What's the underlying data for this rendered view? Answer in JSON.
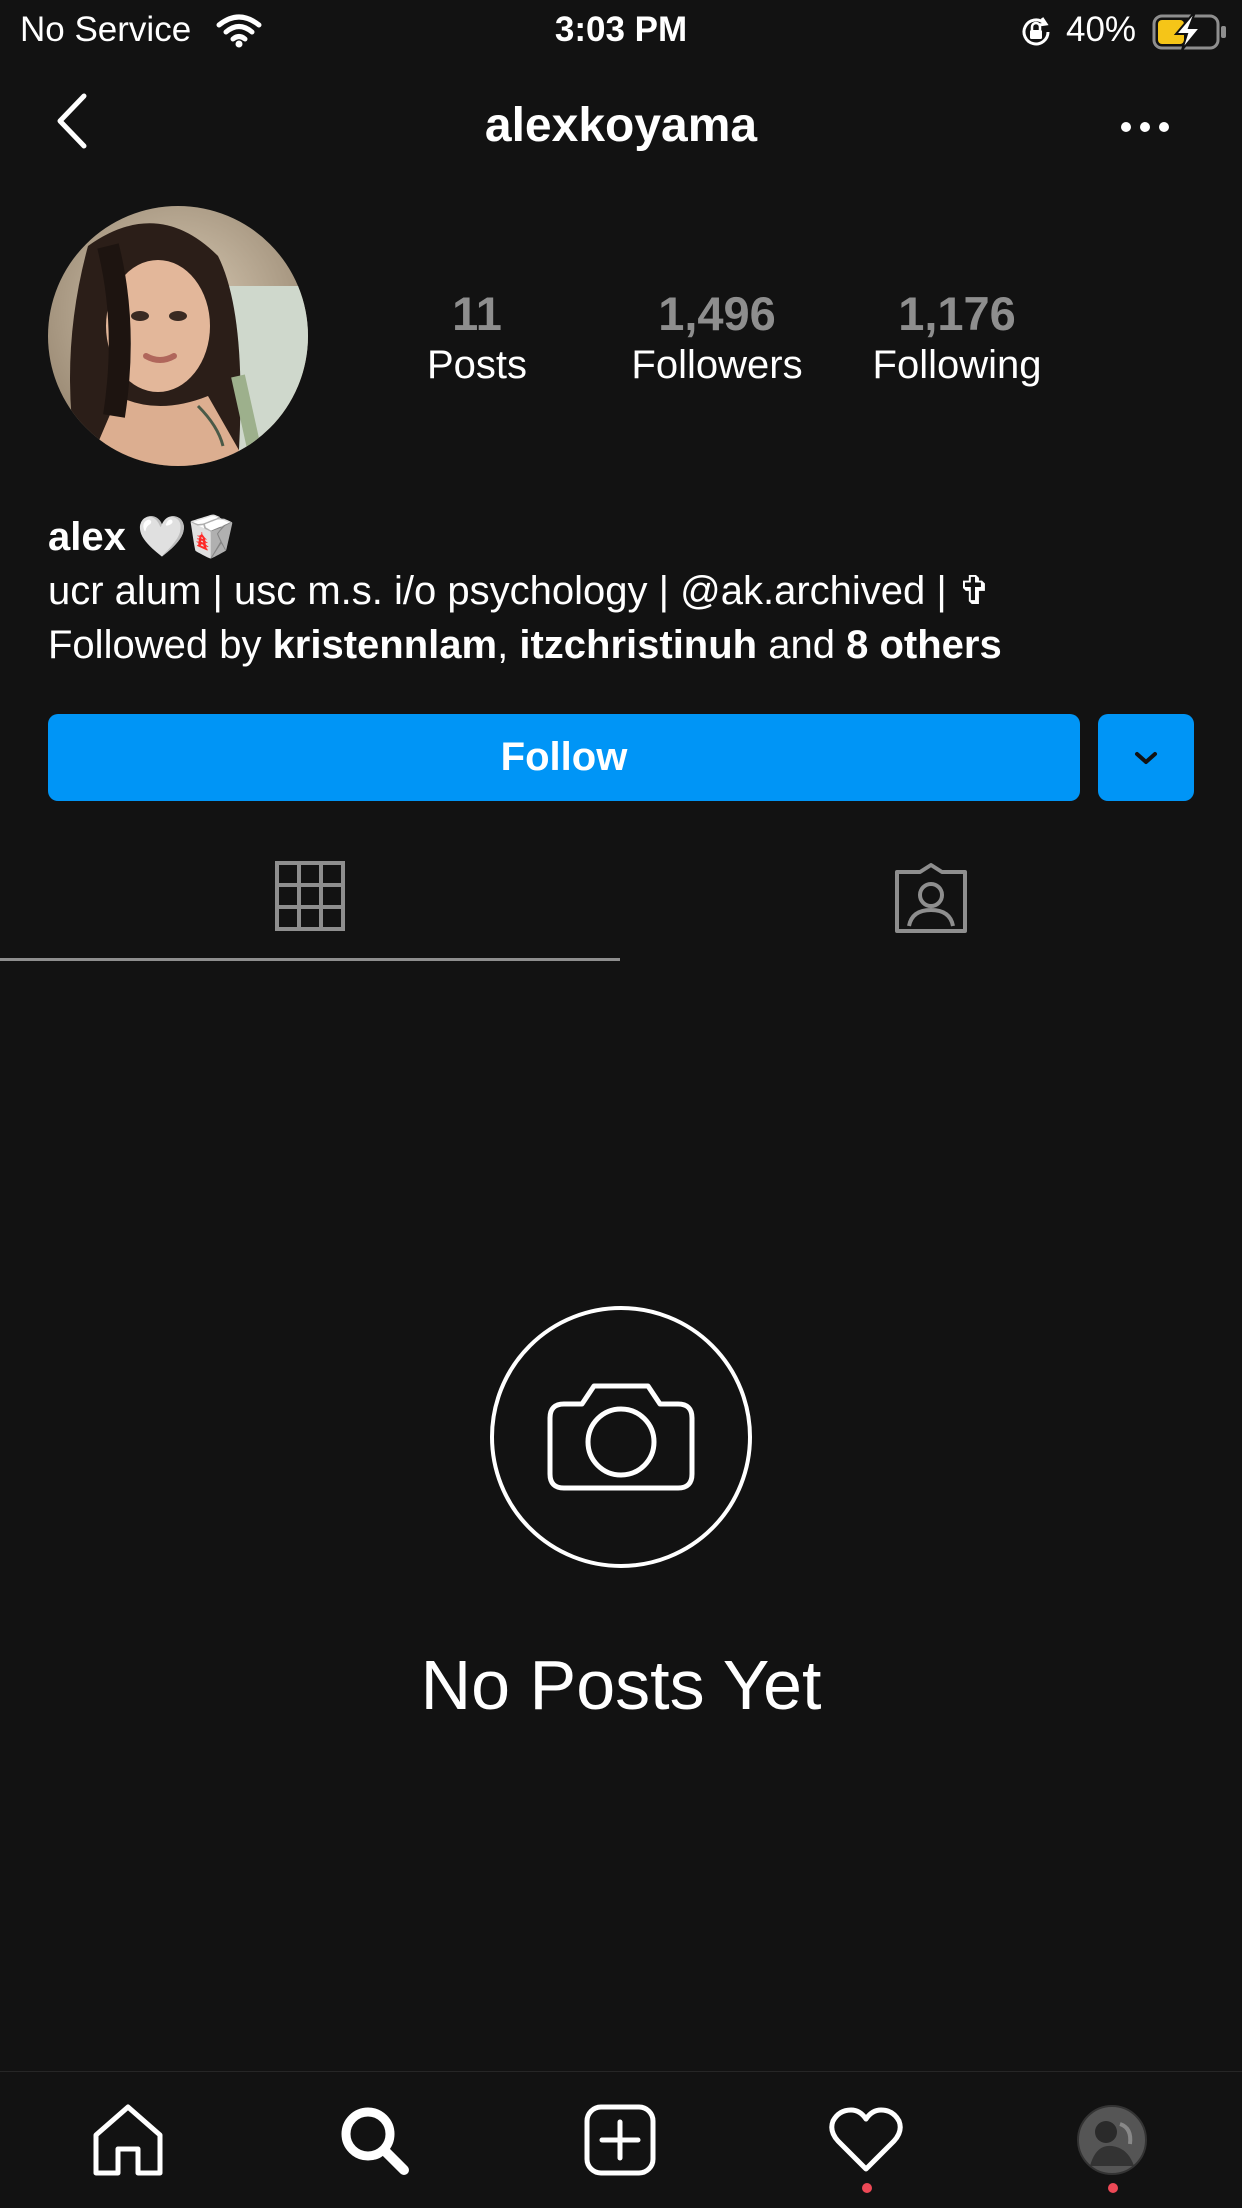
{
  "status_bar": {
    "carrier": "No Service",
    "time": "3:03 PM",
    "battery": "40%"
  },
  "header": {
    "username": "alexkoyama"
  },
  "stats": [
    {
      "value": "11",
      "label": "Posts"
    },
    {
      "value": "1,496",
      "label": "Followers"
    },
    {
      "value": "1,176",
      "label": "Following"
    }
  ],
  "bio": {
    "name": "alex",
    "name_emoji": "🤍🥡",
    "text": "ucr alum | usc m.s. i/o psychology | @ak.archived | ✞",
    "followed_prefix": "Followed by ",
    "follower1": "kristennlam",
    "separator": ", ",
    "follower2": "itzchristinuh",
    "and_text": " and ",
    "others": "8 others"
  },
  "actions": {
    "follow_label": "Follow"
  },
  "empty_state": {
    "title": "No Posts Yet"
  },
  "colors": {
    "background": "#121212",
    "accent": "#0095f6",
    "muted": "#8e8e8e",
    "notification": "#ed4956"
  },
  "icons": [
    "back-icon",
    "more-icon",
    "grid-icon",
    "tagged-icon",
    "camera-icon",
    "home-icon",
    "search-icon",
    "new-post-icon",
    "activity-icon",
    "profile-icon",
    "wifi-icon",
    "orientation-lock-icon",
    "battery-icon"
  ]
}
